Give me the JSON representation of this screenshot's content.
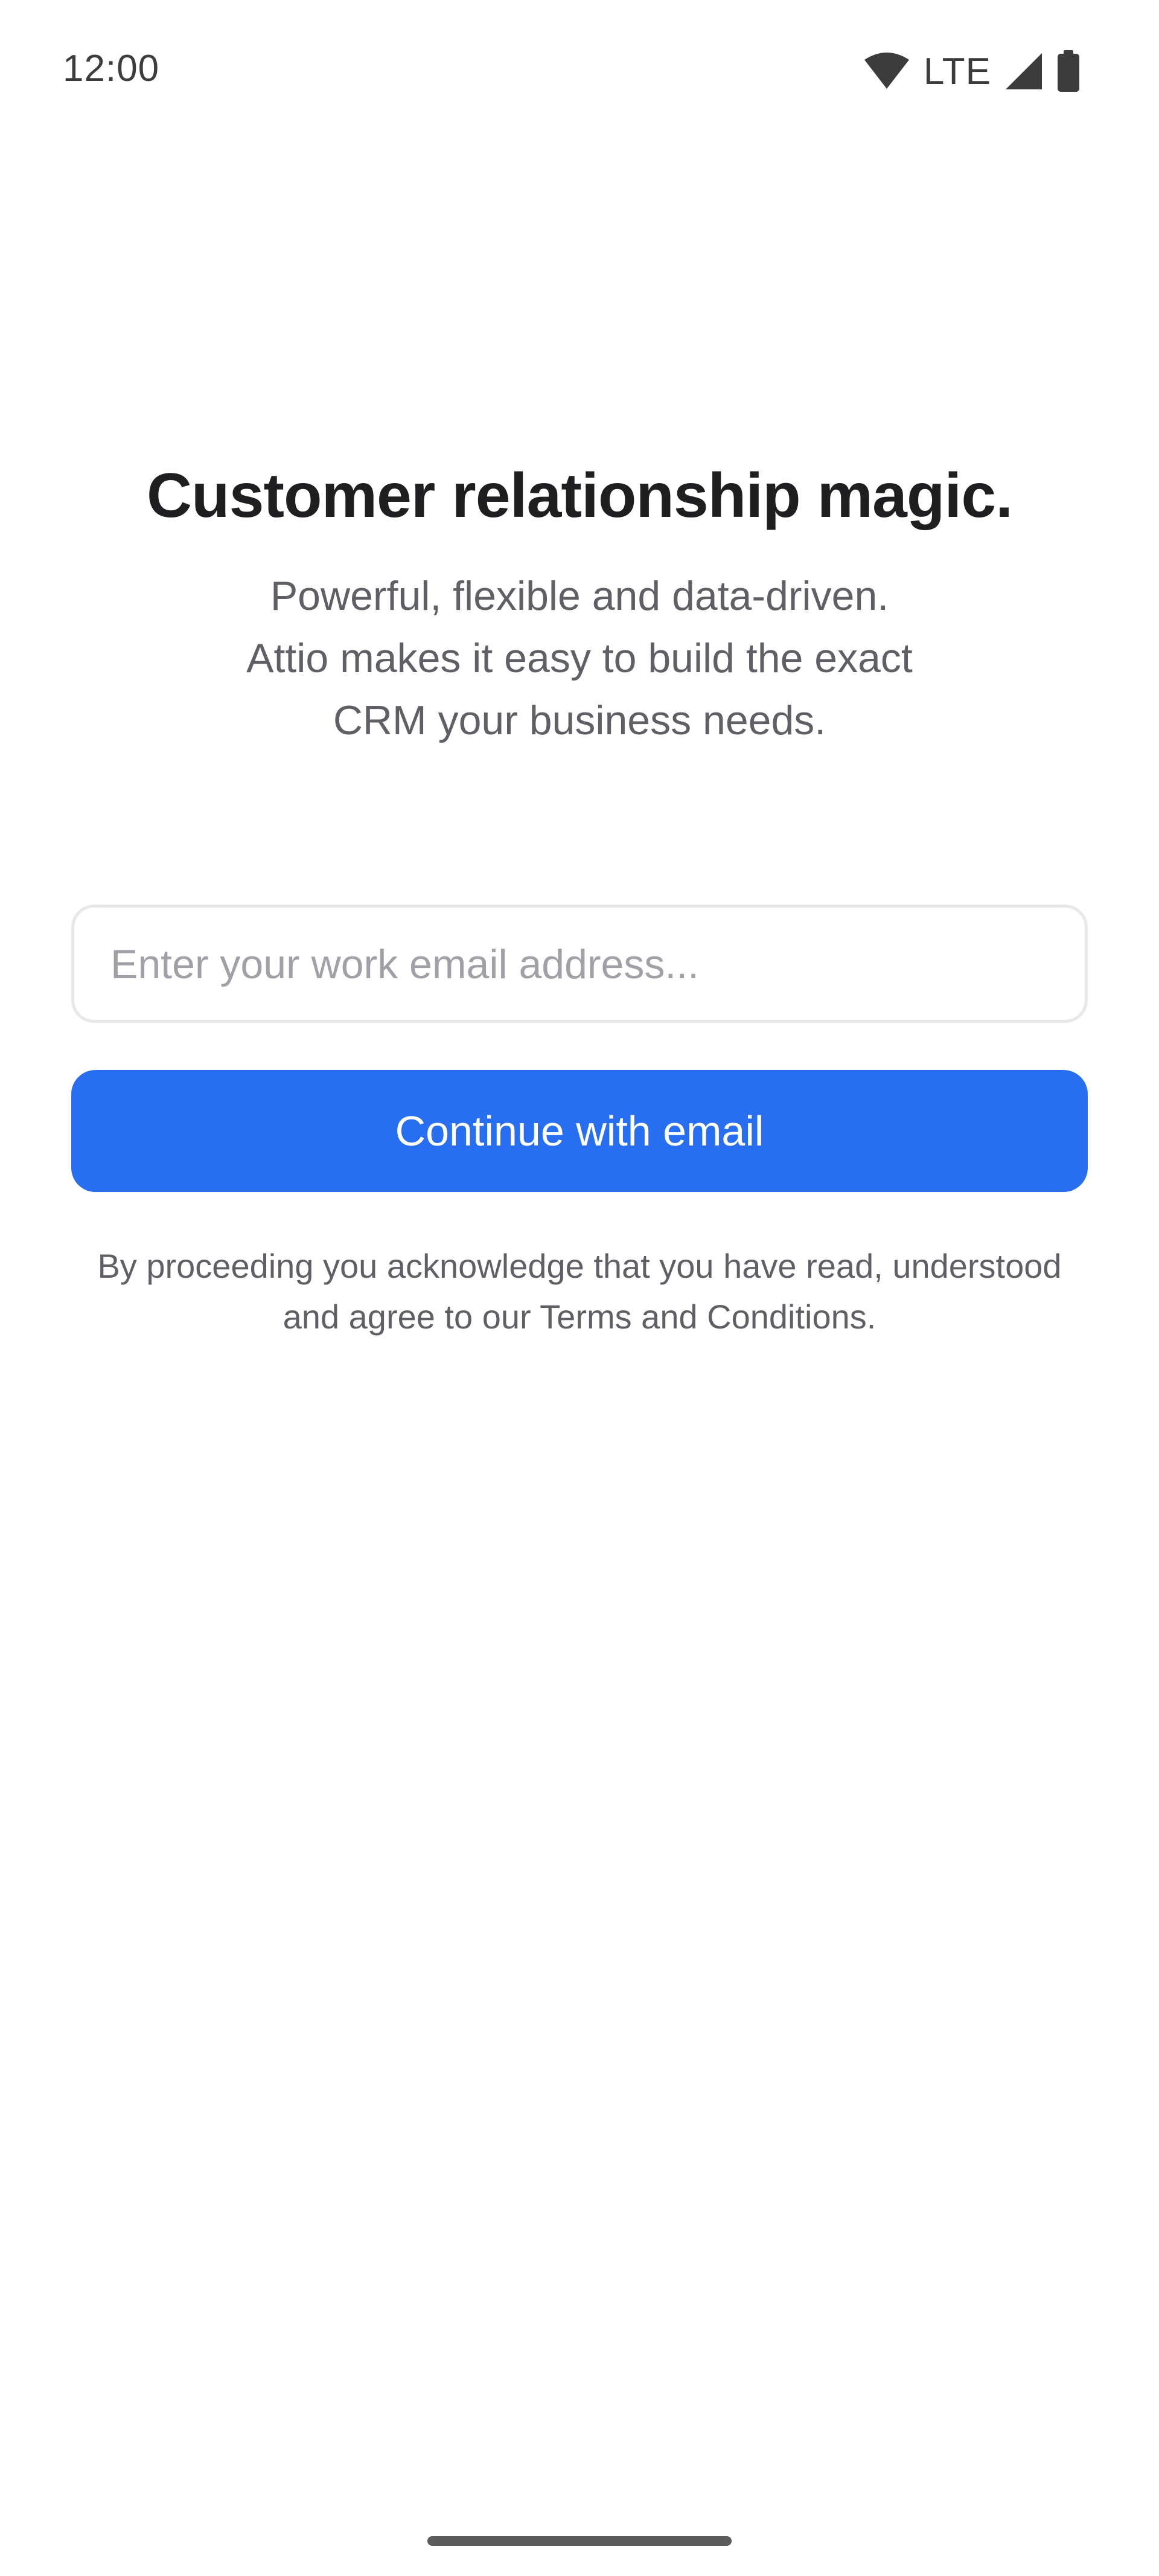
{
  "status_bar": {
    "time": "12:00",
    "network": "LTE",
    "icons": [
      "wifi-icon",
      "cellular-signal-icon",
      "battery-icon"
    ]
  },
  "hero": {
    "title": "Customer relationship magic.",
    "subtitle_lines": [
      "Powerful, flexible and data-driven.",
      "Attio makes it easy to build the exact",
      "CRM your business needs."
    ]
  },
  "form": {
    "email_placeholder": "Enter your work email address...",
    "email_value": "",
    "continue_label": "Continue with email"
  },
  "legal": {
    "lines": [
      "By proceeding you acknowledge that you have read, understood",
      "and agree to our Terms and Conditions."
    ]
  },
  "colors": {
    "primary_button": "#276ef1",
    "title_text": "#1f1f22",
    "body_text": "#5f5f66",
    "input_border": "#e8e8ea",
    "background": "#ffffff"
  }
}
